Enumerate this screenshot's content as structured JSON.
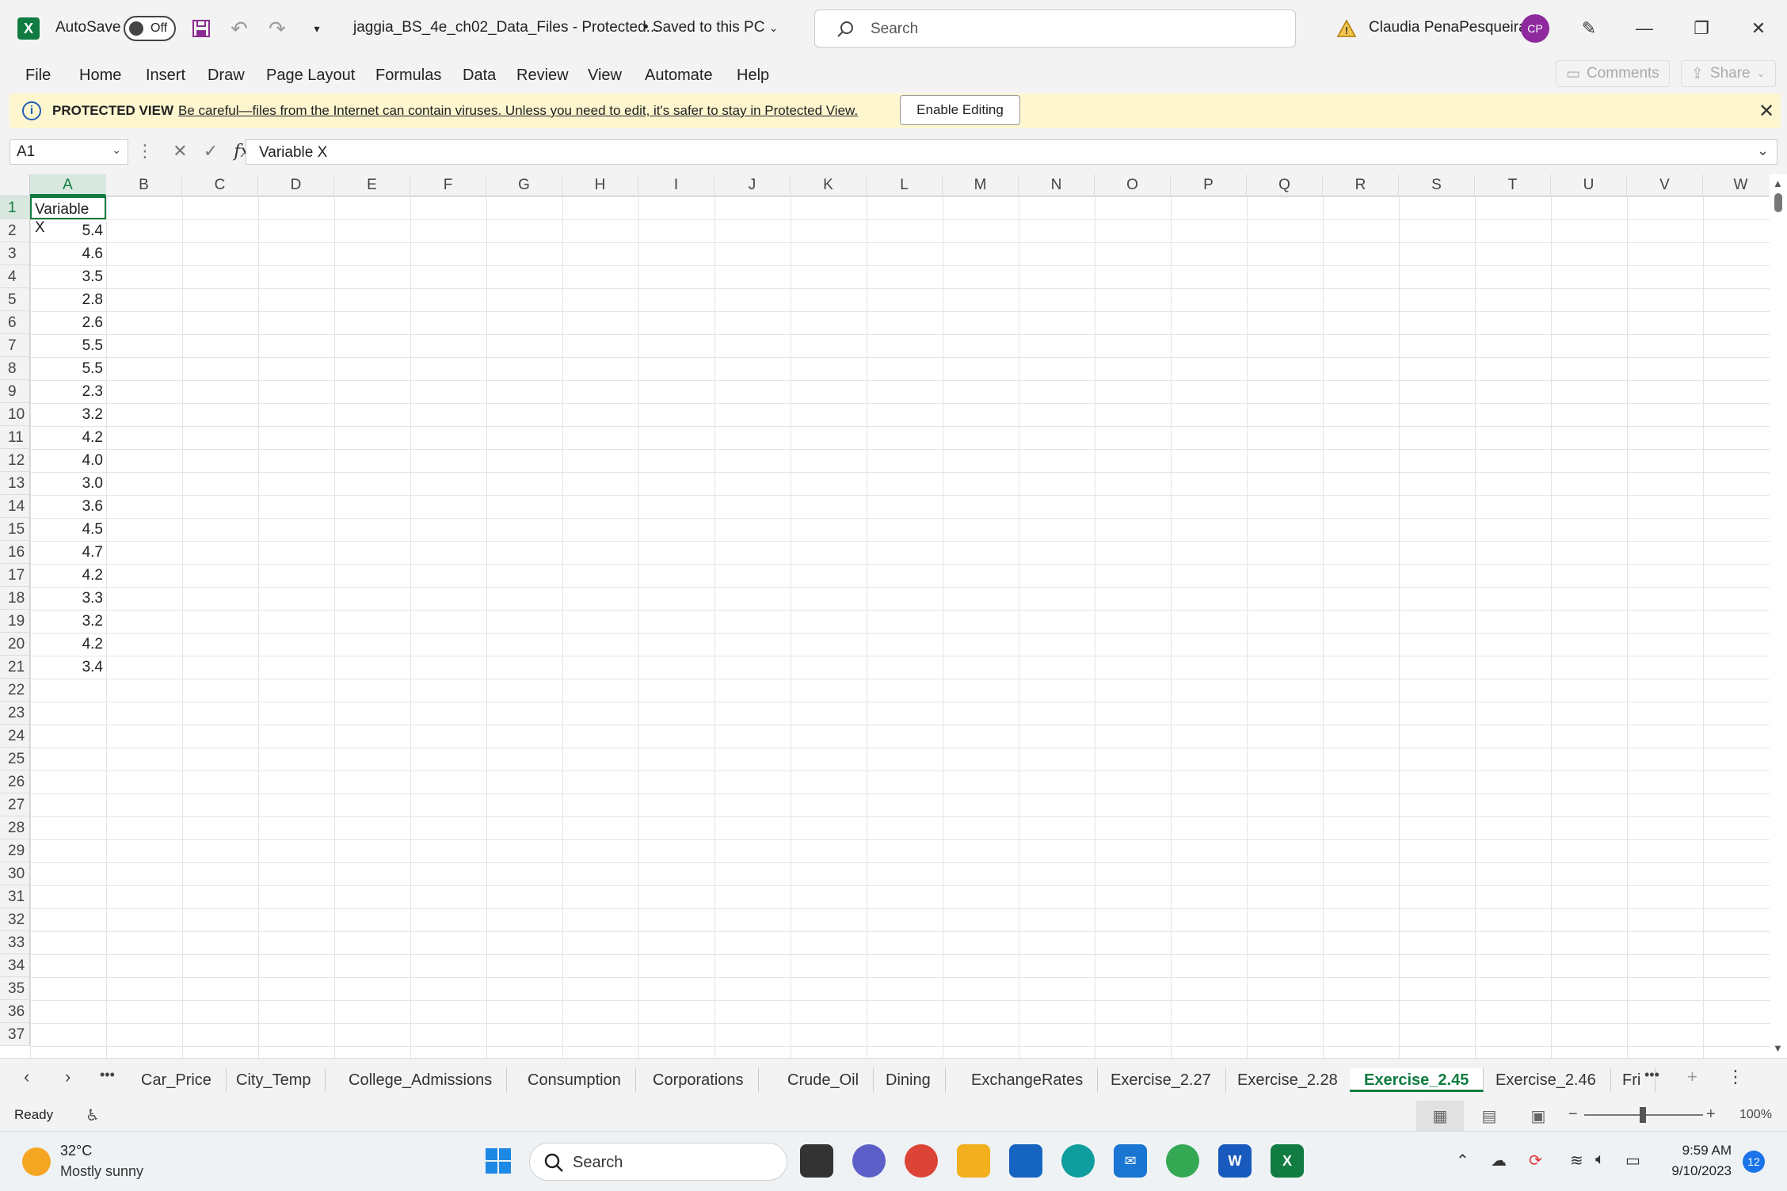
{
  "titlebar": {
    "autosave_label": "AutoSave",
    "autosave_state": "Off",
    "document_title": "jaggia_BS_4e_ch02_Data_Files  -  Protected...",
    "saved_status": "• Saved to this PC",
    "search_placeholder": "Search",
    "user_name": "Claudia PenaPesqueira",
    "user_initials": "CP"
  },
  "menu": {
    "items": [
      "File",
      "Home",
      "Insert",
      "Draw",
      "Page Layout",
      "Formulas",
      "Data",
      "Review",
      "View",
      "Automate",
      "Help"
    ],
    "comments_label": "Comments",
    "share_label": "Share"
  },
  "protected_view": {
    "title": "PROTECTED VIEW",
    "message": "Be careful—files from the Internet can contain viruses. Unless you need to edit, it's safer to stay in Protected View.",
    "button": "Enable Editing"
  },
  "formula_bar": {
    "name_box": "A1",
    "formula": "Variable X"
  },
  "sheet": {
    "columns": [
      "A",
      "B",
      "C",
      "D",
      "E",
      "F",
      "G",
      "H",
      "I",
      "J",
      "K",
      "L",
      "M",
      "N",
      "O",
      "P",
      "Q",
      "R",
      "S",
      "T",
      "U",
      "V",
      "W"
    ],
    "rows": [
      "1",
      "2",
      "3",
      "4",
      "5",
      "6",
      "7",
      "8",
      "9",
      "10",
      "11",
      "12",
      "13",
      "14",
      "15",
      "16",
      "17",
      "18",
      "19",
      "20",
      "21",
      "22",
      "23",
      "24",
      "25",
      "26",
      "27",
      "28",
      "29",
      "30",
      "31",
      "32",
      "33",
      "34",
      "35",
      "36",
      "37"
    ],
    "column_a": [
      "Variable X",
      "5.4",
      "4.6",
      "3.5",
      "2.8",
      "2.6",
      "5.5",
      "5.5",
      "2.3",
      "3.2",
      "4.2",
      "4.0",
      "3.0",
      "3.6",
      "4.5",
      "4.7",
      "4.2",
      "3.3",
      "3.2",
      "4.2",
      "3.4"
    ]
  },
  "tabs": {
    "items": [
      "Car_Price",
      "City_Temp",
      "College_Admissions",
      "Consumption",
      "Corporations",
      "Crude_Oil",
      "Dining",
      "ExchangeRates",
      "Exercise_2.27",
      "Exercise_2.28",
      "Exercise_2.45",
      "Exercise_2.46",
      "Fri"
    ],
    "active": "Exercise_2.45"
  },
  "status": {
    "ready": "Ready",
    "zoom": "100%"
  },
  "taskbar": {
    "weather_temp": "32°C",
    "weather_desc": "Mostly sunny",
    "search_placeholder": "Search",
    "time": "9:59 AM",
    "date": "9/10/2023",
    "notifications": "12"
  }
}
